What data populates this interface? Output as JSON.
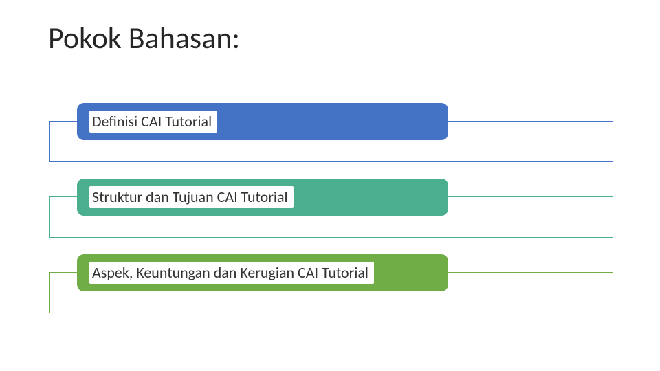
{
  "title": "Pokok Bahasan:",
  "items": [
    {
      "label": "Definisi CAI Tutorial"
    },
    {
      "label": "Struktur dan Tujuan CAI Tutorial"
    },
    {
      "label": "Aspek, Keuntungan dan Kerugian CAI Tutorial"
    }
  ]
}
